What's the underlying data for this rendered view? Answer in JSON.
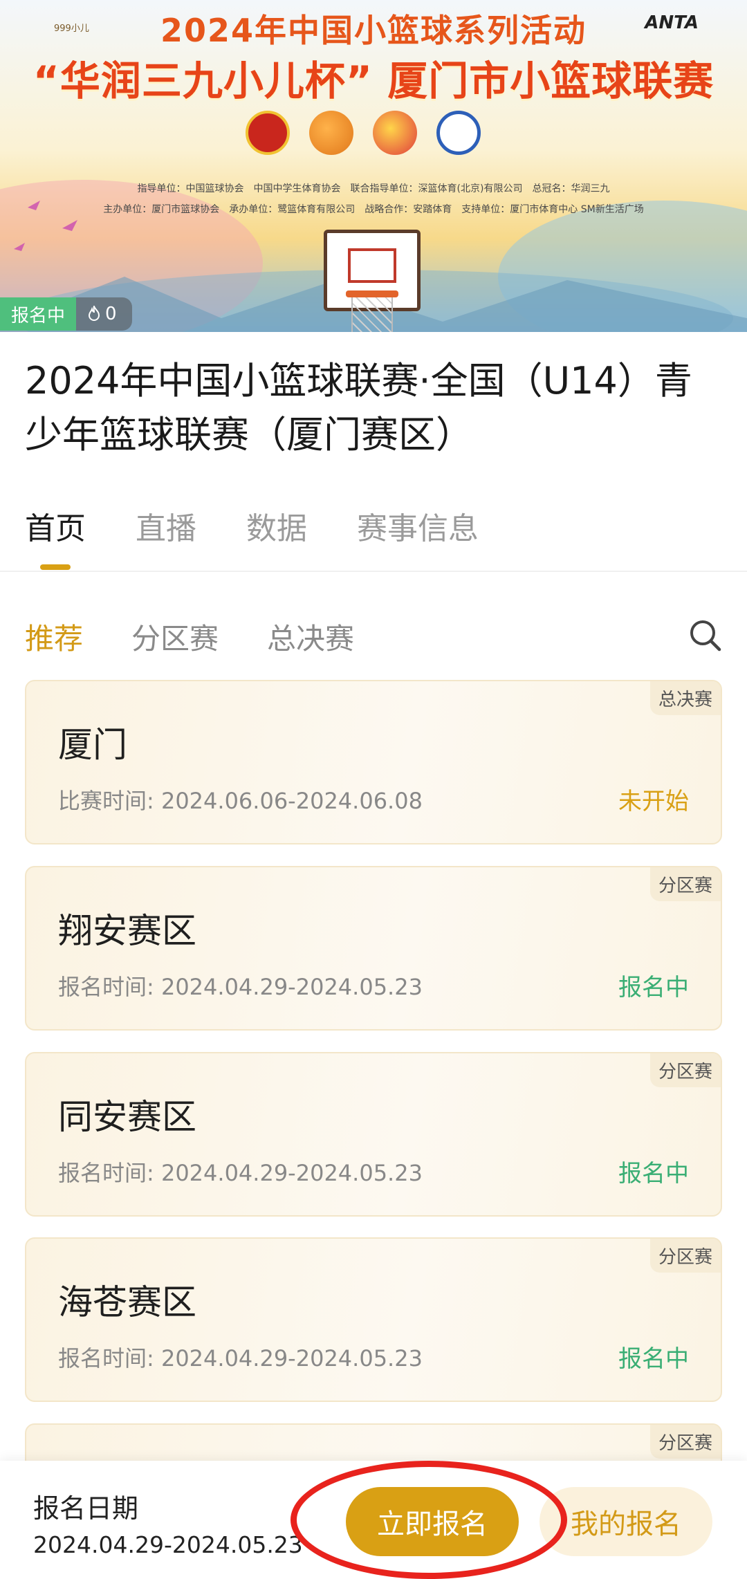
{
  "banner": {
    "brand": "999小儿",
    "anta": "ANTA",
    "title_line1": "2024年中国小篮球系列活动",
    "title_line2": "“华润三九小儿杯” 厦门市小篮球联赛",
    "sponsors_line1": "指导单位：中国篮球协会　中国中学生体育协会　联合指导单位：深篮体育(北京)有限公司　总冠名：华润三九",
    "sponsors_line2": "主办单位：厦门市篮球协会　承办单位：鹭篮体育有限公司　战略合作：安踏体育　支持单位：厦门市体育中心 SM新生活广场",
    "status_label": "报名中",
    "hot_count": "0"
  },
  "event_title": "2024年中国小篮球联赛·全国（U14）青少年篮球联赛（厦门赛区）",
  "main_tabs": [
    {
      "label": "首页",
      "active": true
    },
    {
      "label": "直播",
      "active": false
    },
    {
      "label": "数据",
      "active": false
    },
    {
      "label": "赛事信息",
      "active": false
    }
  ],
  "sub_tabs": [
    {
      "label": "推荐",
      "active": true
    },
    {
      "label": "分区赛",
      "active": false
    },
    {
      "label": "总决赛",
      "active": false
    }
  ],
  "cards": [
    {
      "tag": "总决赛",
      "name": "厦门",
      "time": "比赛时间: 2024.06.06-2024.06.08",
      "status": "未开始"
    },
    {
      "tag": "分区赛",
      "name": "翔安赛区",
      "time": "报名时间: 2024.04.29-2024.05.23",
      "status": "报名中"
    },
    {
      "tag": "分区赛",
      "name": "同安赛区",
      "time": "报名时间: 2024.04.29-2024.05.23",
      "status": "报名中"
    },
    {
      "tag": "分区赛",
      "name": "海苍赛区",
      "time": "报名时间: 2024.04.29-2024.05.23",
      "status": "报名中"
    },
    {
      "tag": "分区赛",
      "name": "",
      "time": "",
      "status": ""
    }
  ],
  "bottom_bar": {
    "label": "报名日期",
    "dates": "2024.04.29-2024.05.23",
    "register_label": "立即报名",
    "my_registration_label": "我的报名"
  },
  "colors": {
    "accent": "#d9a014",
    "open_status": "#3aae74",
    "highlight_ring": "#e8231d"
  },
  "icons": [
    "fire-icon",
    "search-icon"
  ]
}
